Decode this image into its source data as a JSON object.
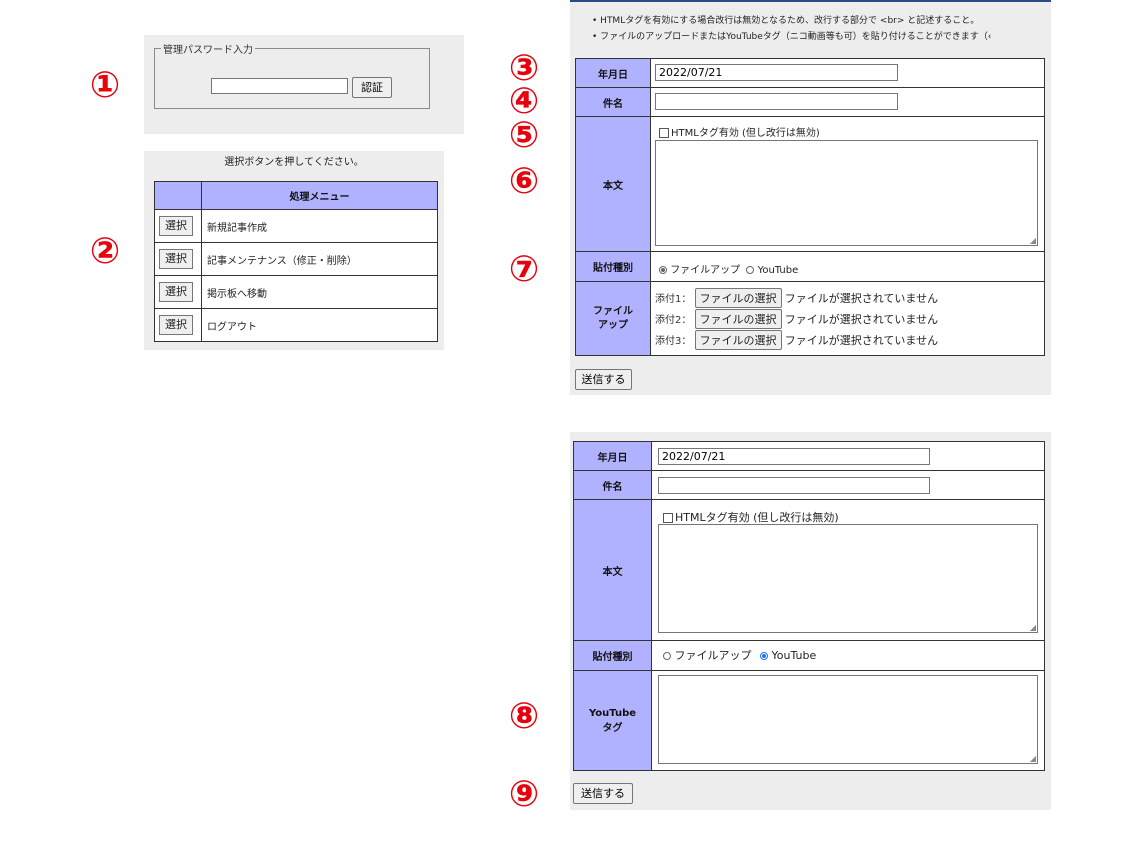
{
  "markers": [
    "①",
    "②",
    "③",
    "④",
    "⑤",
    "⑥",
    "⑦",
    "⑧",
    "⑨"
  ],
  "login": {
    "legend": "管理パスワード入力",
    "password_value": "",
    "auth_button": "認証"
  },
  "menu": {
    "instruction": "選択ボタンを押してください。",
    "header": "処理メニュー",
    "select_label": "選択",
    "items": [
      "新規記事作成",
      "記事メンテナンス（修正・削除）",
      "掲示板へ移動",
      "ログアウト"
    ]
  },
  "form1": {
    "notes": [
      "HTMLタグを有効にする場合改行は無効となるため、改行する部分で <br> と記述すること。",
      "ファイルのアップロードまたはYouTubeタグ（ニコ動画等も可）を貼り付けることができます（‹"
    ],
    "date_label": "年月日",
    "date_value": "2022/07/21",
    "subject_label": "件名",
    "subject_value": "",
    "body_label": "本文",
    "html_checkbox": "HTMLタグ有効 (但し改行は無効)",
    "attach_type_label": "貼付種別",
    "radio_file": "ファイルアップ",
    "radio_youtube": "YouTube",
    "file_label_line1": "ファイル",
    "file_label_line2": "アップ",
    "attachments": [
      {
        "label": "添付1：",
        "button": "ファイルの選択",
        "status": "ファイルが選択されていません"
      },
      {
        "label": "添付2：",
        "button": "ファイルの選択",
        "status": "ファイルが選択されていません"
      },
      {
        "label": "添付3：",
        "button": "ファイルの選択",
        "status": "ファイルが選択されていません"
      }
    ],
    "submit": "送信する"
  },
  "form2": {
    "date_label": "年月日",
    "date_value": "2022/07/21",
    "subject_label": "件名",
    "subject_value": "",
    "body_label": "本文",
    "html_checkbox": "HTMLタグ有効 (但し改行は無効)",
    "attach_type_label": "貼付種別",
    "radio_file": "ファイルアップ",
    "radio_youtube": "YouTube",
    "youtube_label_line1": "YouTube",
    "youtube_label_line2": "タグ",
    "submit": "送信する"
  },
  "colors": {
    "marker": "#e8000d",
    "header_bg": "#b1b2ff",
    "panel_bg": "#ededed"
  }
}
